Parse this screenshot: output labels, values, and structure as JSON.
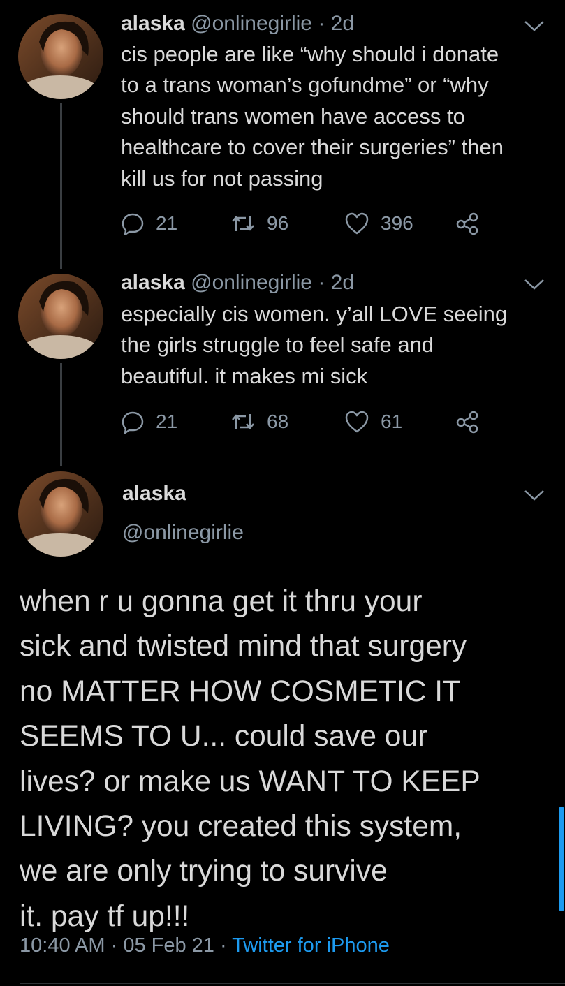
{
  "tweets": [
    {
      "name": "alaska",
      "handle": "@onlinegirlie",
      "time_sep": " · ",
      "time": "2d",
      "text": "cis people are like “why should i donate\nto a trans woman’s gofundme” or “why\nshould trans women have access to\nhealthcare to cover their surgeries” then\nkill us for not passing",
      "replies": "21",
      "retweets": "96",
      "likes": "396"
    },
    {
      "name": "alaska",
      "handle": "@onlinegirlie",
      "time_sep": " · ",
      "time": "2d",
      "text": "especially cis women. y’all LOVE seeing\nthe girls struggle to feel safe and\nbeautiful. it makes mi sick",
      "replies": "21",
      "retweets": "68",
      "likes": "61"
    }
  ],
  "main_tweet": {
    "name": "alaska",
    "handle": "@onlinegirlie",
    "text": "when r u gonna get it thru your\nsick and twisted mind that surgery\nno MATTER HOW COSMETIC IT\nSEEMS TO U... could save our\nlives? or make us WANT TO KEEP\nLIVING? you created this system,\nwe are only trying to survive\nit. pay tf up!!!",
    "time": "10:40 AM",
    "sep1": " · ",
    "date": "05 Feb 21",
    "sep2": " · ",
    "source": "Twitter for iPhone"
  },
  "icons": {
    "reply": "reply-icon",
    "retweet": "retweet-icon",
    "like": "heart-icon",
    "share": "share-icon",
    "more": "chevron-down-icon"
  },
  "colors": {
    "background": "#000000",
    "text": "#d9d9d9",
    "secondary": "#8b98a5",
    "link": "#1d9bf0"
  }
}
